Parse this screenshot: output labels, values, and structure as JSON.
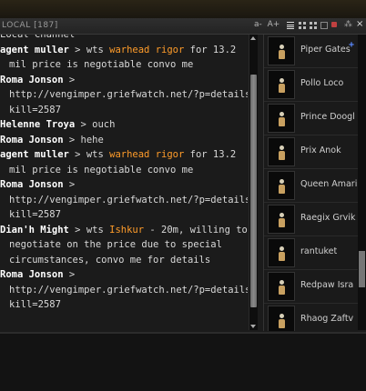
{
  "window": {
    "title": "LOCAL [187]"
  },
  "toolbar": {
    "font_smaller": "a-",
    "font_larger": "A+"
  },
  "chat": {
    "channel_line": "Local Channel",
    "messages": [
      {
        "speaker": "agent muller",
        "sep": " > ",
        "pre": "wts ",
        "item": "warhead rigor",
        "post": " for 13.2",
        "cont": "mil price is negotiable convo me"
      },
      {
        "speaker": "Roma Jonson",
        "sep": " >",
        "link1": "http://vengimper.griefwatch.net/?p=details&",
        "link2": "kill=2587"
      },
      {
        "speaker": "Helenne Troya",
        "sep": " > ",
        "text": "ouch"
      },
      {
        "speaker": "Roma Jonson",
        "sep": " > ",
        "text": "hehe"
      },
      {
        "speaker": "agent muller",
        "sep": " > ",
        "pre": "wts ",
        "item": "warhead rigor",
        "post": " for 13.2",
        "cont": "mil price is negotiable convo me"
      },
      {
        "speaker": "Roma Jonson",
        "sep": " >",
        "link1": "http://vengimper.griefwatch.net/?p=details&",
        "link2": "kill=2587"
      },
      {
        "speaker": "Dian'h Might",
        "sep": " > ",
        "pre": "wts ",
        "item": "Ishkur",
        "post": " - 20m, willing to",
        "cont": "negotiate on the price due to special",
        "cont2": "circumstances, convo me for details"
      },
      {
        "speaker": "Roma Jonson",
        "sep": " >",
        "link1": "http://vengimper.griefwatch.net/?p=details&",
        "link2": "kill=2587"
      }
    ]
  },
  "members": [
    {
      "name": "Piper Gates"
    },
    {
      "name": "Pollo Loco"
    },
    {
      "name": "Prince Doogl"
    },
    {
      "name": "Prix Anok"
    },
    {
      "name": "Queen Amari"
    },
    {
      "name": "Raegix Grvik"
    },
    {
      "name": "rantuket"
    },
    {
      "name": "Redpaw Isra"
    },
    {
      "name": "Rhaog Zaftv"
    }
  ],
  "colors": {
    "speaker": "#ffffff",
    "item_highlight": "#ff9c2a",
    "link": "#ffa93a",
    "text": "#d9d9d9"
  }
}
